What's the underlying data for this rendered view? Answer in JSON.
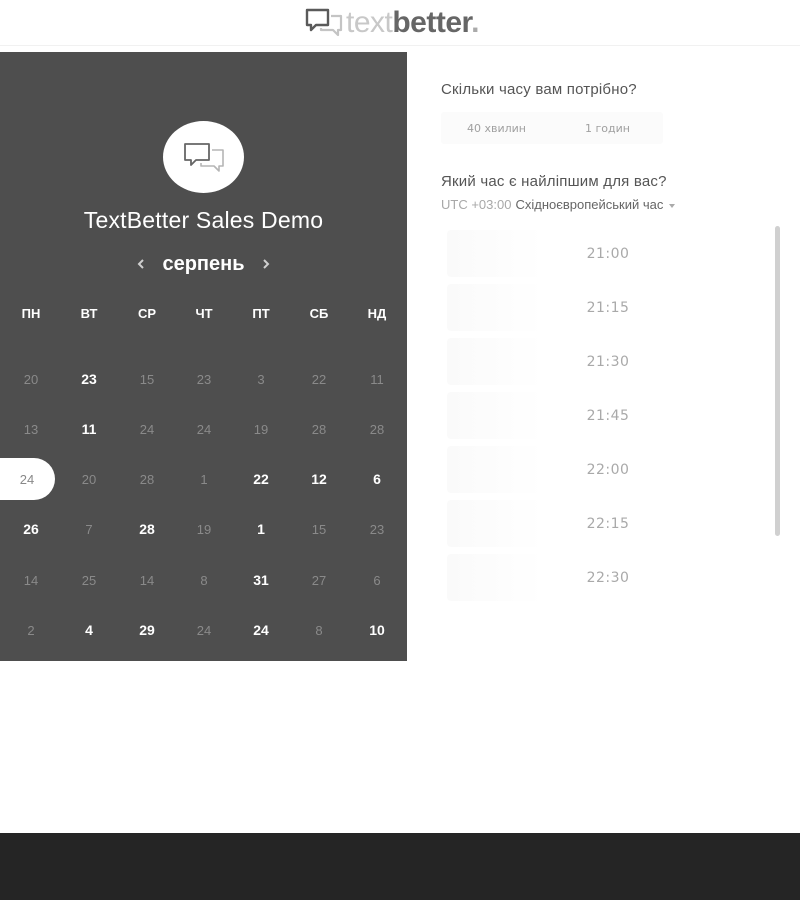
{
  "header": {
    "logo_light": "text",
    "logo_bold": "better",
    "logo_dot": "."
  },
  "calendar": {
    "event_title": "TextBetter Sales Demo",
    "month": "серпень",
    "weekdays": [
      "ПН",
      "ВТ",
      "СР",
      "ЧТ",
      "ПТ",
      "СБ",
      "НД"
    ],
    "weeks": [
      [
        {
          "d": "20",
          "s": "muted"
        },
        {
          "d": "23",
          "s": "available"
        },
        {
          "d": "15",
          "s": "muted"
        },
        {
          "d": "23",
          "s": "muted"
        },
        {
          "d": "3",
          "s": "muted"
        },
        {
          "d": "22",
          "s": "muted"
        },
        {
          "d": "11",
          "s": "muted"
        }
      ],
      [
        {
          "d": "13",
          "s": "muted"
        },
        {
          "d": "11",
          "s": "available"
        },
        {
          "d": "24",
          "s": "muted"
        },
        {
          "d": "24",
          "s": "muted"
        },
        {
          "d": "19",
          "s": "muted"
        },
        {
          "d": "28",
          "s": "muted"
        },
        {
          "d": "28",
          "s": "muted"
        }
      ],
      [
        {
          "d": "24",
          "s": "selected"
        },
        {
          "d": "20",
          "s": "muted"
        },
        {
          "d": "28",
          "s": "muted"
        },
        {
          "d": "1",
          "s": "muted"
        },
        {
          "d": "22",
          "s": "available"
        },
        {
          "d": "12",
          "s": "available"
        },
        {
          "d": "6",
          "s": "available"
        }
      ],
      [
        {
          "d": "26",
          "s": "available"
        },
        {
          "d": "7",
          "s": "muted"
        },
        {
          "d": "28",
          "s": "available"
        },
        {
          "d": "19",
          "s": "muted"
        },
        {
          "d": "1",
          "s": "available"
        },
        {
          "d": "15",
          "s": "muted"
        },
        {
          "d": "23",
          "s": "muted"
        }
      ],
      [
        {
          "d": "14",
          "s": "muted"
        },
        {
          "d": "25",
          "s": "muted"
        },
        {
          "d": "14",
          "s": "muted"
        },
        {
          "d": "8",
          "s": "muted"
        },
        {
          "d": "31",
          "s": "available"
        },
        {
          "d": "27",
          "s": "muted"
        },
        {
          "d": "6",
          "s": "muted"
        }
      ],
      [
        {
          "d": "2",
          "s": "muted"
        },
        {
          "d": "4",
          "s": "available"
        },
        {
          "d": "29",
          "s": "available"
        },
        {
          "d": "24",
          "s": "muted"
        },
        {
          "d": "24",
          "s": "available"
        },
        {
          "d": "8",
          "s": "muted"
        },
        {
          "d": "10",
          "s": "available"
        }
      ]
    ]
  },
  "booking": {
    "duration_question": "Скільки часу вам потрібно?",
    "durations": [
      "40 хвилин",
      "1 годин"
    ],
    "time_question": "Який час є найліпшим для вас?",
    "timezone_offset": "UTC +03:00",
    "timezone_name": "Східноєвропейський час",
    "slots": [
      "21:00",
      "21:15",
      "21:30",
      "21:45",
      "22:00",
      "22:15",
      "22:30"
    ]
  },
  "colors": {
    "panel": "#4e4e4e",
    "footer": "#252525",
    "muted_day": "#8a8a8a",
    "slot_text": "#a9a9a9"
  }
}
